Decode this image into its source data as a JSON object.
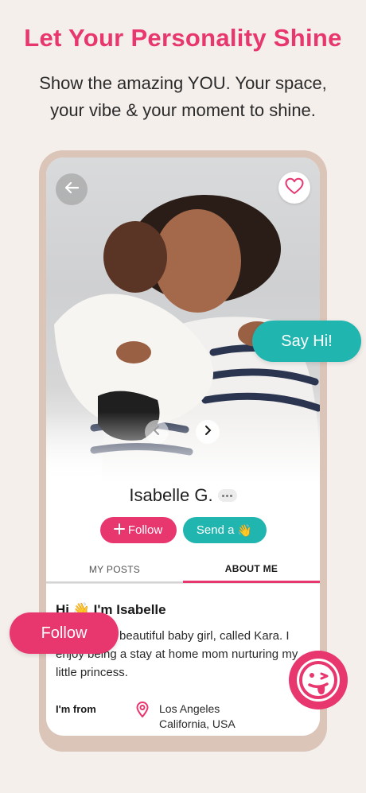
{
  "header": {
    "headline": "Let Your Personality Shine",
    "subline_1": "Show the amazing YOU. Your space,",
    "subline_2": "your vibe & your moment to shine."
  },
  "colors": {
    "brand_pink": "#e8366f",
    "brand_teal": "#21b5b0",
    "background": "#f5efec",
    "phone_frame": "#dbc4b8"
  },
  "profile": {
    "name": "Isabelle G.",
    "follow_label": "Follow",
    "send_label": "Send a",
    "send_emoji": "👋",
    "tabs": [
      {
        "label": "MY POSTS",
        "active": false
      },
      {
        "label": "ABOUT ME",
        "active": true
      }
    ],
    "about": {
      "greeting": "Hi 👋 I'm Isabelle",
      "bio": "Mother to a beautiful baby girl, called Kara. I enjoy being a stay at home mom nurturing my little princess.",
      "from_label": "I'm from",
      "from_city": "Los Angeles",
      "from_region": "California, USA"
    }
  },
  "floating": {
    "say_hi": "Say Hi!",
    "follow": "Follow"
  },
  "icons": {
    "back": "arrow-left-icon",
    "favorite": "heart-icon",
    "prev": "chevron-left-icon",
    "next": "chevron-right-icon",
    "location": "location-pin-icon",
    "emoji": "tongue-face-icon"
  }
}
